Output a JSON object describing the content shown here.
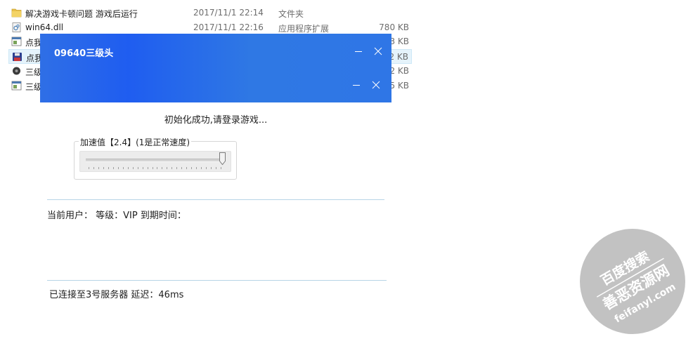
{
  "file_list": {
    "rows": [
      {
        "name": "解决游戏卡顿问题   游戏后运行",
        "date": "2017/11/1 22:14",
        "type": "文件夹",
        "size": "",
        "icon": "folder-icon"
      },
      {
        "name": "win64.dll",
        "date": "2017/11/1 22:16",
        "type": "应用程序扩展",
        "size": "780 KB",
        "icon": "dll-file-icon"
      },
      {
        "name": "点我",
        "date": "",
        "type": "",
        "size": "3 KB",
        "icon": "window-file-icon"
      },
      {
        "name": "点我",
        "date": "",
        "type": "",
        "size": "2 KB",
        "icon": "floppy-save-icon"
      },
      {
        "name": "三级",
        "date": "",
        "type": "",
        "size": "2 KB",
        "icon": "gear-file-icon"
      },
      {
        "name": "三级",
        "date": "",
        "type": "",
        "size": "5 KB",
        "icon": "window-file-icon"
      }
    ]
  },
  "app": {
    "title": "09640三级头",
    "status_message": "初始化成功,请登录游戏...",
    "speed": {
      "label": "加速值【2.4】(1是正常速度)",
      "value_fraction": 0.98
    },
    "user_info": "当前用户：  等级：VIP  到期时间：",
    "connection": "已连接至3号服务器  延迟：46ms"
  },
  "watermark": {
    "line1": "百度搜索",
    "line2": "善恶资源网",
    "line3": "feifanyl.com"
  },
  "colors": {
    "title_bar": "#2f6fe6",
    "divider": "#b7d4e6",
    "watermark": "#bdbdbd"
  }
}
